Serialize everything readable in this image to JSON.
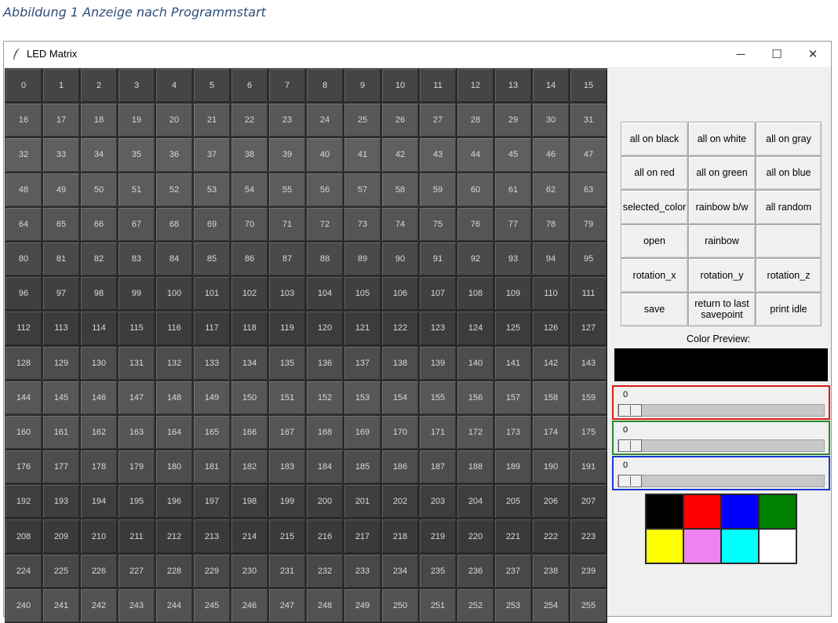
{
  "caption": "Abbildung 1 Anzeige nach Programmstart",
  "window": {
    "title": "LED Matrix",
    "icon": "feather-icon",
    "controls": {
      "minimize": "─",
      "maximize": "☐",
      "close": "✕"
    }
  },
  "matrix": {
    "cells": [
      {
        "label": "0",
        "color": "#454545"
      },
      {
        "label": "1",
        "color": "#454545"
      },
      {
        "label": "2",
        "color": "#454545"
      },
      {
        "label": "3",
        "color": "#454545"
      },
      {
        "label": "4",
        "color": "#454545"
      },
      {
        "label": "5",
        "color": "#454545"
      },
      {
        "label": "6",
        "color": "#454545"
      },
      {
        "label": "7",
        "color": "#454545"
      },
      {
        "label": "8",
        "color": "#454545"
      },
      {
        "label": "9",
        "color": "#454545"
      },
      {
        "label": "10",
        "color": "#454545"
      },
      {
        "label": "11",
        "color": "#454545"
      },
      {
        "label": "12",
        "color": "#454545"
      },
      {
        "label": "13",
        "color": "#454545"
      },
      {
        "label": "14",
        "color": "#454545"
      },
      {
        "label": "15",
        "color": "#454545"
      },
      {
        "label": "16",
        "color": "#585858"
      },
      {
        "label": "17",
        "color": "#585858"
      },
      {
        "label": "18",
        "color": "#585858"
      },
      {
        "label": "19",
        "color": "#585858"
      },
      {
        "label": "20",
        "color": "#585858"
      },
      {
        "label": "21",
        "color": "#585858"
      },
      {
        "label": "22",
        "color": "#585858"
      },
      {
        "label": "23",
        "color": "#585858"
      },
      {
        "label": "24",
        "color": "#585858"
      },
      {
        "label": "25",
        "color": "#585858"
      },
      {
        "label": "26",
        "color": "#585858"
      },
      {
        "label": "27",
        "color": "#585858"
      },
      {
        "label": "28",
        "color": "#585858"
      },
      {
        "label": "29",
        "color": "#585858"
      },
      {
        "label": "30",
        "color": "#585858"
      },
      {
        "label": "31",
        "color": "#585858"
      },
      {
        "label": "32",
        "color": "#5f5f5f"
      },
      {
        "label": "33",
        "color": "#5f5f5f"
      },
      {
        "label": "34",
        "color": "#5f5f5f"
      },
      {
        "label": "35",
        "color": "#5f5f5f"
      },
      {
        "label": "36",
        "color": "#5f5f5f"
      },
      {
        "label": "37",
        "color": "#5f5f5f"
      },
      {
        "label": "38",
        "color": "#5f5f5f"
      },
      {
        "label": "39",
        "color": "#5f5f5f"
      },
      {
        "label": "40",
        "color": "#5f5f5f"
      },
      {
        "label": "41",
        "color": "#5f5f5f"
      },
      {
        "label": "42",
        "color": "#5f5f5f"
      },
      {
        "label": "43",
        "color": "#5f5f5f"
      },
      {
        "label": "44",
        "color": "#5f5f5f"
      },
      {
        "label": "45",
        "color": "#5f5f5f"
      },
      {
        "label": "46",
        "color": "#5f5f5f"
      },
      {
        "label": "47",
        "color": "#5f5f5f"
      },
      {
        "label": "48",
        "color": "#5c5c5c"
      },
      {
        "label": "49",
        "color": "#5c5c5c"
      },
      {
        "label": "50",
        "color": "#5c5c5c"
      },
      {
        "label": "51",
        "color": "#5c5c5c"
      },
      {
        "label": "52",
        "color": "#5c5c5c"
      },
      {
        "label": "53",
        "color": "#5c5c5c"
      },
      {
        "label": "54",
        "color": "#5c5c5c"
      },
      {
        "label": "55",
        "color": "#5c5c5c"
      },
      {
        "label": "56",
        "color": "#5c5c5c"
      },
      {
        "label": "57",
        "color": "#5c5c5c"
      },
      {
        "label": "58",
        "color": "#5c5c5c"
      },
      {
        "label": "59",
        "color": "#5c5c5c"
      },
      {
        "label": "60",
        "color": "#5c5c5c"
      },
      {
        "label": "61",
        "color": "#5c5c5c"
      },
      {
        "label": "62",
        "color": "#5c5c5c"
      },
      {
        "label": "63",
        "color": "#5c5c5c"
      },
      {
        "label": "64",
        "color": "#555555"
      },
      {
        "label": "65",
        "color": "#555555"
      },
      {
        "label": "66",
        "color": "#555555"
      },
      {
        "label": "67",
        "color": "#555555"
      },
      {
        "label": "68",
        "color": "#555555"
      },
      {
        "label": "69",
        "color": "#555555"
      },
      {
        "label": "70",
        "color": "#555555"
      },
      {
        "label": "71",
        "color": "#555555"
      },
      {
        "label": "72",
        "color": "#555555"
      },
      {
        "label": "73",
        "color": "#555555"
      },
      {
        "label": "74",
        "color": "#555555"
      },
      {
        "label": "75",
        "color": "#555555"
      },
      {
        "label": "76",
        "color": "#555555"
      },
      {
        "label": "77",
        "color": "#555555"
      },
      {
        "label": "78",
        "color": "#555555"
      },
      {
        "label": "79",
        "color": "#555555"
      },
      {
        "label": "80",
        "color": "#4a4a4a"
      },
      {
        "label": "81",
        "color": "#4a4a4a"
      },
      {
        "label": "82",
        "color": "#4a4a4a"
      },
      {
        "label": "83",
        "color": "#4a4a4a"
      },
      {
        "label": "84",
        "color": "#4a4a4a"
      },
      {
        "label": "85",
        "color": "#4a4a4a"
      },
      {
        "label": "86",
        "color": "#4a4a4a"
      },
      {
        "label": "87",
        "color": "#4a4a4a"
      },
      {
        "label": "88",
        "color": "#4a4a4a"
      },
      {
        "label": "89",
        "color": "#4a4a4a"
      },
      {
        "label": "90",
        "color": "#4a4a4a"
      },
      {
        "label": "91",
        "color": "#4a4a4a"
      },
      {
        "label": "92",
        "color": "#4a4a4a"
      },
      {
        "label": "93",
        "color": "#4a4a4a"
      },
      {
        "label": "94",
        "color": "#4a4a4a"
      },
      {
        "label": "95",
        "color": "#4a4a4a"
      },
      {
        "label": "96",
        "color": "#404040"
      },
      {
        "label": "97",
        "color": "#404040"
      },
      {
        "label": "98",
        "color": "#404040"
      },
      {
        "label": "99",
        "color": "#404040"
      },
      {
        "label": "100",
        "color": "#404040"
      },
      {
        "label": "101",
        "color": "#404040"
      },
      {
        "label": "102",
        "color": "#404040"
      },
      {
        "label": "103",
        "color": "#404040"
      },
      {
        "label": "104",
        "color": "#404040"
      },
      {
        "label": "105",
        "color": "#404040"
      },
      {
        "label": "106",
        "color": "#404040"
      },
      {
        "label": "107",
        "color": "#404040"
      },
      {
        "label": "108",
        "color": "#404040"
      },
      {
        "label": "109",
        "color": "#404040"
      },
      {
        "label": "110",
        "color": "#404040"
      },
      {
        "label": "111",
        "color": "#404040"
      },
      {
        "label": "112",
        "color": "#3c3c3c"
      },
      {
        "label": "113",
        "color": "#3c3c3c"
      },
      {
        "label": "114",
        "color": "#3c3c3c"
      },
      {
        "label": "115",
        "color": "#3c3c3c"
      },
      {
        "label": "116",
        "color": "#3c3c3c"
      },
      {
        "label": "117",
        "color": "#3c3c3c"
      },
      {
        "label": "118",
        "color": "#3c3c3c"
      },
      {
        "label": "119",
        "color": "#3c3c3c"
      },
      {
        "label": "120",
        "color": "#3c3c3c"
      },
      {
        "label": "121",
        "color": "#3c3c3c"
      },
      {
        "label": "122",
        "color": "#3c3c3c"
      },
      {
        "label": "123",
        "color": "#3c3c3c"
      },
      {
        "label": "124",
        "color": "#3c3c3c"
      },
      {
        "label": "125",
        "color": "#3c3c3c"
      },
      {
        "label": "126",
        "color": "#3c3c3c"
      },
      {
        "label": "127",
        "color": "#3c3c3c"
      },
      {
        "label": "128",
        "color": "#4d4d4d"
      },
      {
        "label": "129",
        "color": "#4d4d4d"
      },
      {
        "label": "130",
        "color": "#4d4d4d"
      },
      {
        "label": "131",
        "color": "#4d4d4d"
      },
      {
        "label": "132",
        "color": "#4d4d4d"
      },
      {
        "label": "133",
        "color": "#4d4d4d"
      },
      {
        "label": "134",
        "color": "#4d4d4d"
      },
      {
        "label": "135",
        "color": "#4d4d4d"
      },
      {
        "label": "136",
        "color": "#4d4d4d"
      },
      {
        "label": "137",
        "color": "#4d4d4d"
      },
      {
        "label": "138",
        "color": "#4d4d4d"
      },
      {
        "label": "139",
        "color": "#4d4d4d"
      },
      {
        "label": "140",
        "color": "#4d4d4d"
      },
      {
        "label": "141",
        "color": "#4d4d4d"
      },
      {
        "label": "142",
        "color": "#4d4d4d"
      },
      {
        "label": "143",
        "color": "#4d4d4d"
      },
      {
        "label": "144",
        "color": "#575757"
      },
      {
        "label": "145",
        "color": "#575757"
      },
      {
        "label": "146",
        "color": "#575757"
      },
      {
        "label": "147",
        "color": "#575757"
      },
      {
        "label": "148",
        "color": "#575757"
      },
      {
        "label": "149",
        "color": "#575757"
      },
      {
        "label": "150",
        "color": "#575757"
      },
      {
        "label": "151",
        "color": "#575757"
      },
      {
        "label": "152",
        "color": "#575757"
      },
      {
        "label": "153",
        "color": "#575757"
      },
      {
        "label": "154",
        "color": "#575757"
      },
      {
        "label": "155",
        "color": "#575757"
      },
      {
        "label": "156",
        "color": "#575757"
      },
      {
        "label": "157",
        "color": "#575757"
      },
      {
        "label": "158",
        "color": "#575757"
      },
      {
        "label": "159",
        "color": "#575757"
      },
      {
        "label": "160",
        "color": "#555555"
      },
      {
        "label": "161",
        "color": "#555555"
      },
      {
        "label": "162",
        "color": "#555555"
      },
      {
        "label": "163",
        "color": "#555555"
      },
      {
        "label": "164",
        "color": "#555555"
      },
      {
        "label": "165",
        "color": "#555555"
      },
      {
        "label": "166",
        "color": "#555555"
      },
      {
        "label": "167",
        "color": "#555555"
      },
      {
        "label": "168",
        "color": "#555555"
      },
      {
        "label": "169",
        "color": "#555555"
      },
      {
        "label": "170",
        "color": "#555555"
      },
      {
        "label": "171",
        "color": "#555555"
      },
      {
        "label": "172",
        "color": "#555555"
      },
      {
        "label": "173",
        "color": "#555555"
      },
      {
        "label": "174",
        "color": "#555555"
      },
      {
        "label": "175",
        "color": "#555555"
      },
      {
        "label": "176",
        "color": "#4d4d4d"
      },
      {
        "label": "177",
        "color": "#4d4d4d"
      },
      {
        "label": "178",
        "color": "#4d4d4d"
      },
      {
        "label": "179",
        "color": "#4d4d4d"
      },
      {
        "label": "180",
        "color": "#4d4d4d"
      },
      {
        "label": "181",
        "color": "#4d4d4d"
      },
      {
        "label": "182",
        "color": "#4d4d4d"
      },
      {
        "label": "183",
        "color": "#4d4d4d"
      },
      {
        "label": "184",
        "color": "#4d4d4d"
      },
      {
        "label": "185",
        "color": "#4d4d4d"
      },
      {
        "label": "186",
        "color": "#4d4d4d"
      },
      {
        "label": "187",
        "color": "#4d4d4d"
      },
      {
        "label": "188",
        "color": "#4d4d4d"
      },
      {
        "label": "189",
        "color": "#4d4d4d"
      },
      {
        "label": "190",
        "color": "#4d4d4d"
      },
      {
        "label": "191",
        "color": "#4d4d4d"
      },
      {
        "label": "192",
        "color": "#3e3e3e"
      },
      {
        "label": "193",
        "color": "#3e3e3e"
      },
      {
        "label": "194",
        "color": "#3e3e3e"
      },
      {
        "label": "195",
        "color": "#3e3e3e"
      },
      {
        "label": "196",
        "color": "#3e3e3e"
      },
      {
        "label": "197",
        "color": "#3e3e3e"
      },
      {
        "label": "198",
        "color": "#3e3e3e"
      },
      {
        "label": "199",
        "color": "#3e3e3e"
      },
      {
        "label": "200",
        "color": "#3e3e3e"
      },
      {
        "label": "201",
        "color": "#3e3e3e"
      },
      {
        "label": "202",
        "color": "#3e3e3e"
      },
      {
        "label": "203",
        "color": "#3e3e3e"
      },
      {
        "label": "204",
        "color": "#3e3e3e"
      },
      {
        "label": "205",
        "color": "#3e3e3e"
      },
      {
        "label": "206",
        "color": "#3e3e3e"
      },
      {
        "label": "207",
        "color": "#3e3e3e"
      },
      {
        "label": "208",
        "color": "#3a3a3a"
      },
      {
        "label": "209",
        "color": "#3a3a3a"
      },
      {
        "label": "210",
        "color": "#3a3a3a"
      },
      {
        "label": "211",
        "color": "#3a3a3a"
      },
      {
        "label": "212",
        "color": "#3a3a3a"
      },
      {
        "label": "213",
        "color": "#3a3a3a"
      },
      {
        "label": "214",
        "color": "#3a3a3a"
      },
      {
        "label": "215",
        "color": "#3a3a3a"
      },
      {
        "label": "216",
        "color": "#3a3a3a"
      },
      {
        "label": "217",
        "color": "#3a3a3a"
      },
      {
        "label": "218",
        "color": "#3a3a3a"
      },
      {
        "label": "219",
        "color": "#3a3a3a"
      },
      {
        "label": "220",
        "color": "#3a3a3a"
      },
      {
        "label": "221",
        "color": "#3a3a3a"
      },
      {
        "label": "222",
        "color": "#3a3a3a"
      },
      {
        "label": "223",
        "color": "#3a3a3a"
      },
      {
        "label": "224",
        "color": "#484848"
      },
      {
        "label": "225",
        "color": "#484848"
      },
      {
        "label": "226",
        "color": "#484848"
      },
      {
        "label": "227",
        "color": "#484848"
      },
      {
        "label": "228",
        "color": "#484848"
      },
      {
        "label": "229",
        "color": "#484848"
      },
      {
        "label": "230",
        "color": "#484848"
      },
      {
        "label": "231",
        "color": "#484848"
      },
      {
        "label": "232",
        "color": "#484848"
      },
      {
        "label": "233",
        "color": "#484848"
      },
      {
        "label": "234",
        "color": "#484848"
      },
      {
        "label": "235",
        "color": "#484848"
      },
      {
        "label": "236",
        "color": "#484848"
      },
      {
        "label": "237",
        "color": "#484848"
      },
      {
        "label": "238",
        "color": "#484848"
      },
      {
        "label": "239",
        "color": "#484848"
      },
      {
        "label": "240",
        "color": "#525252"
      },
      {
        "label": "241",
        "color": "#525252"
      },
      {
        "label": "242",
        "color": "#525252"
      },
      {
        "label": "243",
        "color": "#525252"
      },
      {
        "label": "244",
        "color": "#525252"
      },
      {
        "label": "245",
        "color": "#525252"
      },
      {
        "label": "246",
        "color": "#525252"
      },
      {
        "label": "247",
        "color": "#525252"
      },
      {
        "label": "248",
        "color": "#525252"
      },
      {
        "label": "249",
        "color": "#525252"
      },
      {
        "label": "250",
        "color": "#525252"
      },
      {
        "label": "251",
        "color": "#525252"
      },
      {
        "label": "252",
        "color": "#525252"
      },
      {
        "label": "253",
        "color": "#525252"
      },
      {
        "label": "254",
        "color": "#525252"
      },
      {
        "label": "255",
        "color": "#525252"
      }
    ]
  },
  "buttons": [
    {
      "name": "all-on-black-button",
      "label": "all on black"
    },
    {
      "name": "all-on-white-button",
      "label": "all on white"
    },
    {
      "name": "all-on-gray-button",
      "label": "all on gray"
    },
    {
      "name": "all-on-red-button",
      "label": "all on red"
    },
    {
      "name": "all-on-green-button",
      "label": "all on green"
    },
    {
      "name": "all-on-blue-button",
      "label": "all on blue"
    },
    {
      "name": "selected-color-button",
      "label": "selected_color"
    },
    {
      "name": "rainbow-bw-button",
      "label": "rainbow b/w"
    },
    {
      "name": "all-random-button",
      "label": "all random"
    },
    {
      "name": "open-button",
      "label": "open"
    },
    {
      "name": "rainbow-button",
      "label": "rainbow"
    },
    {
      "name": "empty-button",
      "label": ""
    },
    {
      "name": "rotation-x-button",
      "label": "rotation_x"
    },
    {
      "name": "rotation-y-button",
      "label": "rotation_y"
    },
    {
      "name": "rotation-z-button",
      "label": "rotation_z"
    },
    {
      "name": "save-button",
      "label": "save"
    },
    {
      "name": "return-savepoint-button",
      "label": "return to last savepoint"
    },
    {
      "name": "print-idle-button",
      "label": "print idle"
    }
  ],
  "preview": {
    "label": "Color Preview:",
    "color": "#000000"
  },
  "sliders": {
    "red": {
      "value": "0",
      "level": 0
    },
    "green": {
      "value": "0",
      "level": 0
    },
    "blue": {
      "value": "0",
      "level": 0
    }
  },
  "swatches": [
    {
      "name": "swatch-black",
      "color": "#000000"
    },
    {
      "name": "swatch-red",
      "color": "#ff0000"
    },
    {
      "name": "swatch-blue",
      "color": "#0000ff"
    },
    {
      "name": "swatch-green",
      "color": "#008000"
    },
    {
      "name": "swatch-yellow",
      "color": "#ffff00"
    },
    {
      "name": "swatch-violet",
      "color": "#ee82ee"
    },
    {
      "name": "swatch-cyan",
      "color": "#00ffff"
    },
    {
      "name": "swatch-white",
      "color": "#ffffff"
    }
  ]
}
